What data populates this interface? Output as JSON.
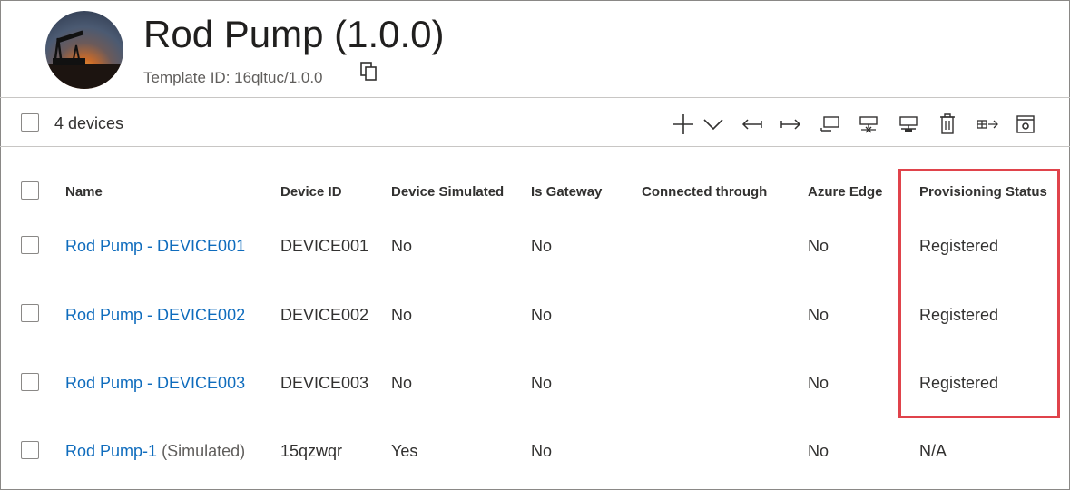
{
  "header": {
    "title": "Rod Pump (1.0.0)",
    "template_label": "Template ID: 16qltuc/1.0.0"
  },
  "toolbar": {
    "device_count": "4 devices",
    "icons": [
      "add-icon",
      "chevron-down-icon",
      "migrate-left-icon",
      "migrate-right-icon",
      "attach-gateway-icon",
      "detach-gateway-icon",
      "manage-gateway-icon",
      "delete-icon",
      "export-icon",
      "settings-icon"
    ]
  },
  "table": {
    "columns": [
      "Name",
      "Device ID",
      "Device Simulated",
      "Is Gateway",
      "Connected through",
      "Azure Edge",
      "Provisioning Status"
    ],
    "rows": [
      {
        "name": "Rod Pump - DEVICE001",
        "suffix": "",
        "device_id": "DEVICE001",
        "simulated": "No",
        "gateway": "No",
        "connected": "",
        "edge": "No",
        "status": "Registered"
      },
      {
        "name": "Rod Pump - DEVICE002",
        "suffix": "",
        "device_id": "DEVICE002",
        "simulated": "No",
        "gateway": "No",
        "connected": "",
        "edge": "No",
        "status": "Registered"
      },
      {
        "name": "Rod Pump - DEVICE003",
        "suffix": "",
        "device_id": "DEVICE003",
        "simulated": "No",
        "gateway": "No",
        "connected": "",
        "edge": "No",
        "status": "Registered"
      },
      {
        "name": "Rod Pump-1",
        "suffix": "(Simulated)",
        "device_id": "15qzwqr",
        "simulated": "Yes",
        "gateway": "No",
        "connected": "",
        "edge": "No",
        "status": "N/A"
      }
    ]
  },
  "colors": {
    "link": "#0f6cbd",
    "highlight_border": "#e0434b",
    "text": "#323130",
    "muted": "#605e5c"
  }
}
